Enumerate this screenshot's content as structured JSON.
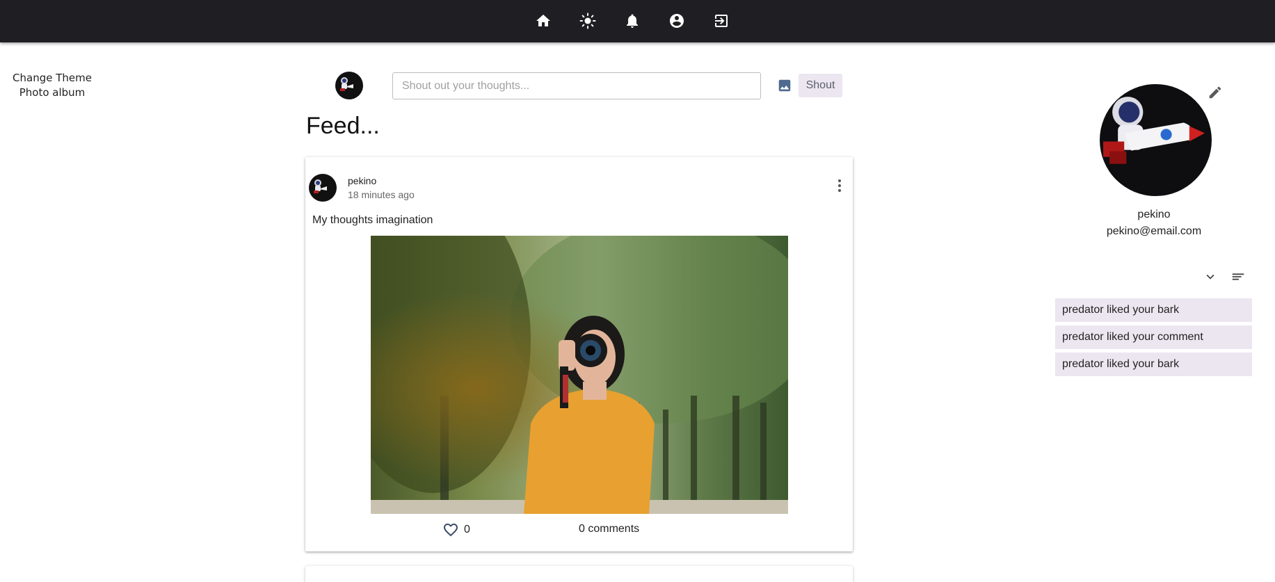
{
  "nav": {
    "icons": [
      "home-icon",
      "theme-sun-icon",
      "bell-icon",
      "account-circle-icon",
      "logout-icon"
    ]
  },
  "left_menu": {
    "change_theme": "Change Theme",
    "photo_album": "Photo album"
  },
  "composer": {
    "placeholder": "Shout out your thoughts...",
    "shout_label": "Shout"
  },
  "feed": {
    "title": "Feed..."
  },
  "post": {
    "author": "pekino",
    "time": "18 minutes ago",
    "text": "My thoughts imagination",
    "likes": "0",
    "comments": "0 comments"
  },
  "profile": {
    "name": "pekino",
    "email": "pekino@email.com"
  },
  "notifications": [
    {
      "text": "predator liked your bark"
    },
    {
      "text": "predator liked your comment"
    },
    {
      "text": "predator liked your bark"
    }
  ],
  "colors": {
    "topbar": "#1f1e22",
    "chip": "#ece6f0"
  }
}
